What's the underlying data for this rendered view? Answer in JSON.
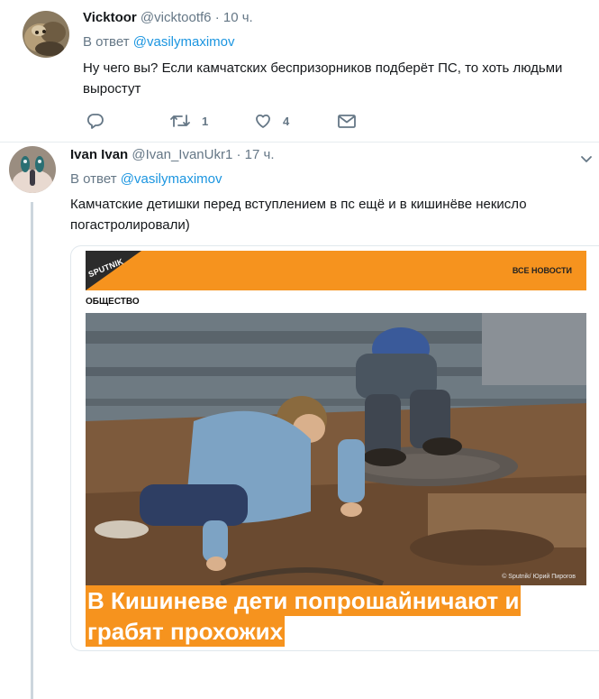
{
  "tweet1": {
    "name": "Vicktoor",
    "handle": "@vicktootf6",
    "dot": "·",
    "time": "10 ч.",
    "reply_prefix": "В ответ",
    "reply_mention": "@vasilymaximov",
    "text_line1": "Ну чего вы? Если камчатских беспризорников подберёт ПС, то хоть людьми",
    "text_line2": "выростут",
    "retweet_count": "1",
    "like_count": "4"
  },
  "tweet2": {
    "name": "Ivan Ivan",
    "handle": "@Ivan_IvanUkr1",
    "dot": "·",
    "time": "17 ч.",
    "reply_prefix": "В ответ",
    "reply_mention": "@vasilymaximov",
    "text_line1": "Камчатские детишки перед вступлением в пс ещё и в кишинёве некисло",
    "text_line2": "погастролировали)"
  },
  "card": {
    "brand": "SPUTNIK",
    "all_news": "ВСЕ НОВОСТИ",
    "section": "ОБЩЕСТВО",
    "credit": "© Sputnik/ Юрий Пирогов",
    "headline_line1": "В Кишиневе дети попрошайничают и",
    "headline_line2": "грабят прохожих"
  },
  "icons": {
    "reply": "reply-icon",
    "retweet": "retweet-icon",
    "like": "heart-icon",
    "dm": "envelope-icon",
    "caret": "chevron-down-icon"
  },
  "colors": {
    "accent": "#1b95e0",
    "muted": "#657786",
    "banner": "#f6931e"
  }
}
